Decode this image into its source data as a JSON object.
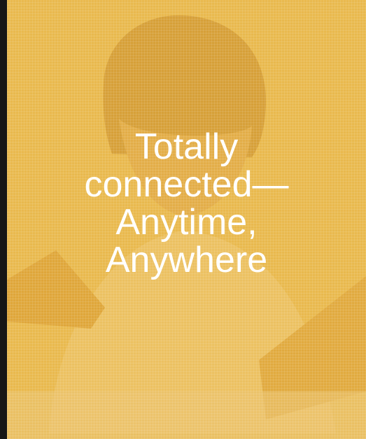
{
  "slide": {
    "headline_lines": [
      "Totally",
      "connected—",
      "Anytime,",
      "Anywhere"
    ],
    "text_color": "#ffffff",
    "tint_color": "#ebbb4f",
    "background_image": "person-with-laptop-photo"
  }
}
